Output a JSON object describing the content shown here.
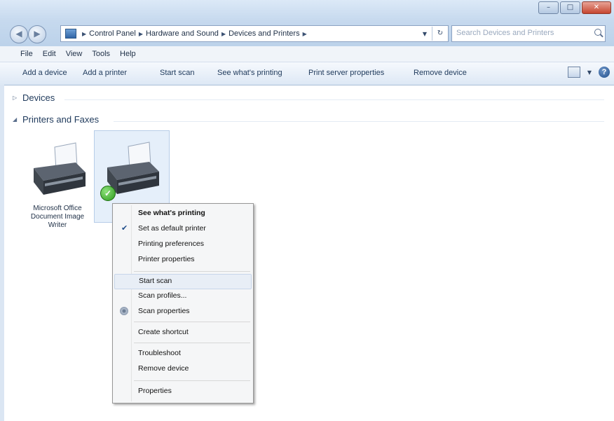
{
  "window": {
    "minimize_glyph": "–",
    "maximize_glyph": "□",
    "close_glyph": "✕"
  },
  "address": {
    "breadcrumbs": [
      "Control Panel",
      "Hardware and Sound",
      "Devices and Printers"
    ],
    "search_placeholder": "Search Devices and Printers"
  },
  "menubar": {
    "items": [
      "File",
      "Edit",
      "View",
      "Tools",
      "Help"
    ]
  },
  "toolbar": {
    "buttons": [
      "Add a device",
      "Add a printer",
      "Start scan",
      "See what's printing",
      "Print server properties",
      "Remove device"
    ]
  },
  "groups": {
    "devices": "Devices",
    "printers": "Printers and Faxes"
  },
  "devices": [
    {
      "label_line1": "Microsoft Office",
      "label_line2": "Document Image",
      "label_line3": "Writer",
      "icon": "printer-icon"
    },
    {
      "label_line1": "",
      "icon": "printer-icon",
      "default": true
    }
  ],
  "context_menu": {
    "items": [
      "See what's printing",
      "Set as default printer",
      "Printing preferences",
      "Printer properties",
      "Start scan",
      "Scan profiles...",
      "Scan properties",
      "Create shortcut",
      "Troubleshoot",
      "Remove device",
      "Properties"
    ],
    "hovered_item": "Start scan",
    "checked_item": "Set as default printer"
  },
  "colors": {
    "accent": "#1e395b",
    "titlebar": "#c6d9ee",
    "selection": "#e5effa"
  }
}
